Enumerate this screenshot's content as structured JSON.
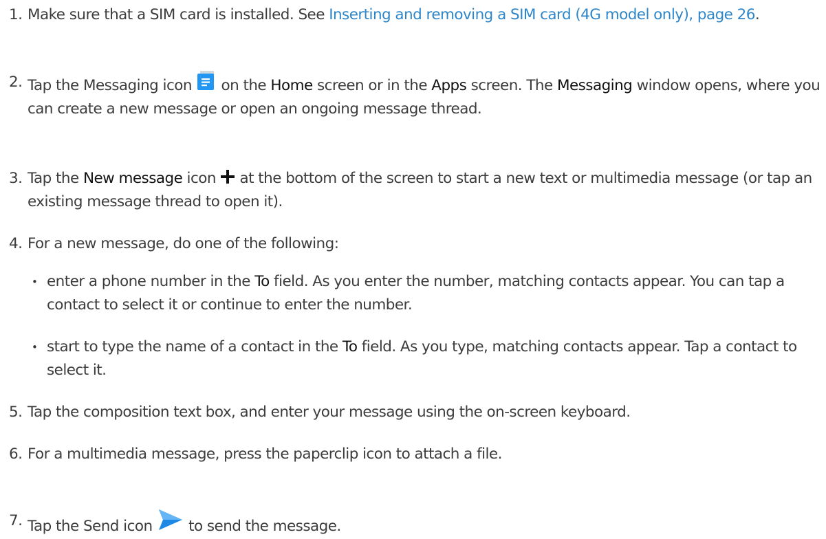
{
  "steps": [
    {
      "num": "1.",
      "text_a": "Make sure that a SIM card is installed. See ",
      "link": "Inserting and removing a SIM card (4G model only), page 26",
      "text_b": "."
    },
    {
      "num": "2.",
      "text_a": "Tap the Messaging icon ",
      "text_b": " on the ",
      "ui_1": "Home",
      "text_c": " screen or in the ",
      "ui_2": "Apps",
      "text_d": " screen. The ",
      "ui_3": "Messaging",
      "text_e": " window opens, where you can create a new message or open an ongoing message thread.",
      "icon": "messaging-icon"
    },
    {
      "num": "3.",
      "text_a": "Tap the ",
      "ui_1": "New message",
      "text_b": " icon ",
      "text_c": " at the bottom of the screen to start a new text or multimedia message (or tap an existing message thread to open it).",
      "icon": "plus-icon"
    },
    {
      "num": "4.",
      "text_a": "For a new message, do one of the following:"
    },
    {
      "num": "5.",
      "text_a": "Tap the composition text box, and enter your message using the on-screen keyboard."
    },
    {
      "num": "6.",
      "text_a": "For a multimedia message, press the paperclip icon to attach a file."
    },
    {
      "num": "7.",
      "text_a": "Tap the Send icon ",
      "text_b": " to send the message.",
      "icon": "send-icon"
    }
  ],
  "sub_items": [
    {
      "bullet": "•",
      "text_a": "enter a phone number in the ",
      "ui": "To",
      "text_b": " field. As you enter the number, matching contacts appear. You can tap a contact to select it or continue to enter the number."
    },
    {
      "bullet": "•",
      "text_a": "start to type the name of a contact in the ",
      "ui": "To",
      "text_b": " field. As you type, matching contacts appear. Tap a contact to select it."
    }
  ],
  "colors": {
    "text": "#3c3c3c",
    "link": "#2e86c8",
    "messaging_icon": "#2196f3",
    "send_icon": "#1e88e5"
  }
}
